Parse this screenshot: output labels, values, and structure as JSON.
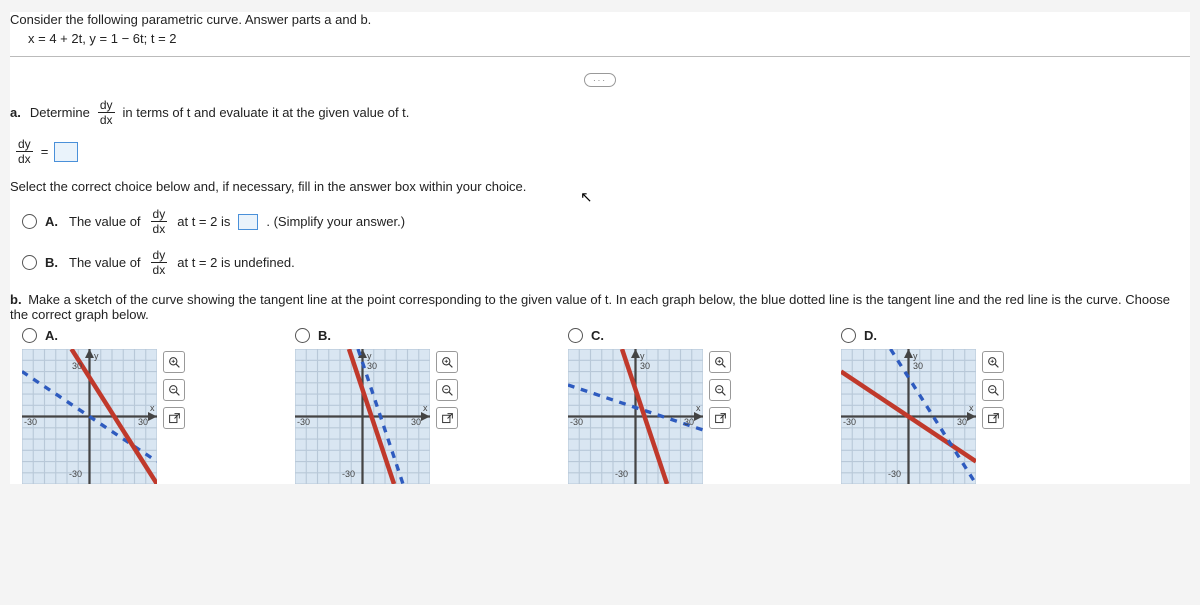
{
  "prompt": {
    "intro": "Consider the following parametric curve. Answer parts a and b.",
    "equation": "x = 4 + 2t,  y = 1 − 6t;  t = 2",
    "collapse": "···"
  },
  "partA": {
    "label": "a.",
    "text1": "Determine",
    "frac_num_1": "dy",
    "frac_den_1": "dx",
    "text2": "in terms of t and evaluate it at the given value of t.",
    "eq_lhs_num": "dy",
    "eq_lhs_den": "dx",
    "eq_sign": "=",
    "select_text": "Select the correct choice below and, if necessary, fill in the answer box within your choice.",
    "optA": {
      "letter": "A.",
      "pre": "The value of",
      "frac_num": "dy",
      "frac_den": "dx",
      "mid": "at t = 2 is",
      "post": ". (Simplify your answer.)"
    },
    "optB": {
      "letter": "B.",
      "pre": "The value of",
      "frac_num": "dy",
      "frac_den": "dx",
      "post": "at t = 2 is undefined."
    }
  },
  "partB": {
    "label": "b.",
    "text": "Make a sketch of the curve showing the tangent line at the point corresponding to the given value of t. In each graph below, the blue dotted line is the tangent line and the red line is the curve. Choose the correct graph below.",
    "optA": "A.",
    "optB": "B.",
    "optC": "C.",
    "optD": "D.",
    "axis": {
      "y": "y",
      "x": "x",
      "t_pos": "30",
      "t_neg_x": "-30",
      "t_neg_y": "-30"
    }
  },
  "chart_data": [
    {
      "type": "line",
      "title": "Option A",
      "xlabel": "x",
      "ylabel": "y",
      "xlim": [
        -30,
        30
      ],
      "ylim": [
        -30,
        30
      ],
      "series": [
        {
          "name": "curve (red)",
          "x": [
            -8,
            30
          ],
          "y": [
            30,
            -30
          ],
          "style": "solid-red"
        },
        {
          "name": "tangent (blue)",
          "x": [
            -30,
            30
          ],
          "y": [
            20,
            -20
          ],
          "style": "dashed-blue"
        }
      ]
    },
    {
      "type": "line",
      "title": "Option B",
      "xlabel": "x",
      "ylabel": "y",
      "xlim": [
        -30,
        30
      ],
      "ylim": [
        -30,
        30
      ],
      "series": [
        {
          "name": "curve (red)",
          "x": [
            -6,
            14
          ],
          "y": [
            30,
            -30
          ],
          "style": "solid-red"
        },
        {
          "name": "tangent (blue)",
          "x": [
            -2,
            18
          ],
          "y": [
            30,
            -30
          ],
          "style": "dashed-blue"
        }
      ]
    },
    {
      "type": "line",
      "title": "Option C",
      "xlabel": "x",
      "ylabel": "y",
      "xlim": [
        -30,
        30
      ],
      "ylim": [
        -30,
        30
      ],
      "series": [
        {
          "name": "curve (red)",
          "x": [
            -6,
            14
          ],
          "y": [
            30,
            -30
          ],
          "style": "solid-red"
        },
        {
          "name": "tangent (blue)",
          "x": [
            -30,
            30
          ],
          "y": [
            14,
            -6
          ],
          "style": "dashed-blue"
        }
      ]
    },
    {
      "type": "line",
      "title": "Option D",
      "xlabel": "x",
      "ylabel": "y",
      "xlim": [
        -30,
        30
      ],
      "ylim": [
        -30,
        30
      ],
      "series": [
        {
          "name": "curve (red)",
          "x": [
            -30,
            30
          ],
          "y": [
            20,
            -20
          ],
          "style": "dashed-blue"
        },
        {
          "name": "tangent (blue)",
          "x": [
            -8,
            30
          ],
          "y": [
            30,
            -30
          ],
          "style": "solid-red"
        }
      ]
    }
  ]
}
